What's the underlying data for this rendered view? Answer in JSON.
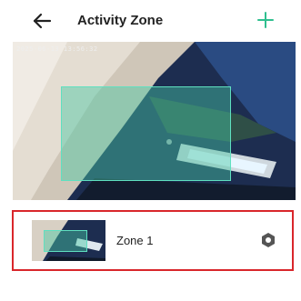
{
  "header": {
    "title": "Activity Zone",
    "back_icon": "back-arrow-icon",
    "add_icon": "plus-icon",
    "accent_color": "#2fbf8f"
  },
  "preview": {
    "timestamp": "2025-06-13 13:56:32"
  },
  "zones": [
    {
      "name": "Zone 1",
      "settings_icon": "gear-icon",
      "selected_border_color": "#d9262b"
    }
  ]
}
